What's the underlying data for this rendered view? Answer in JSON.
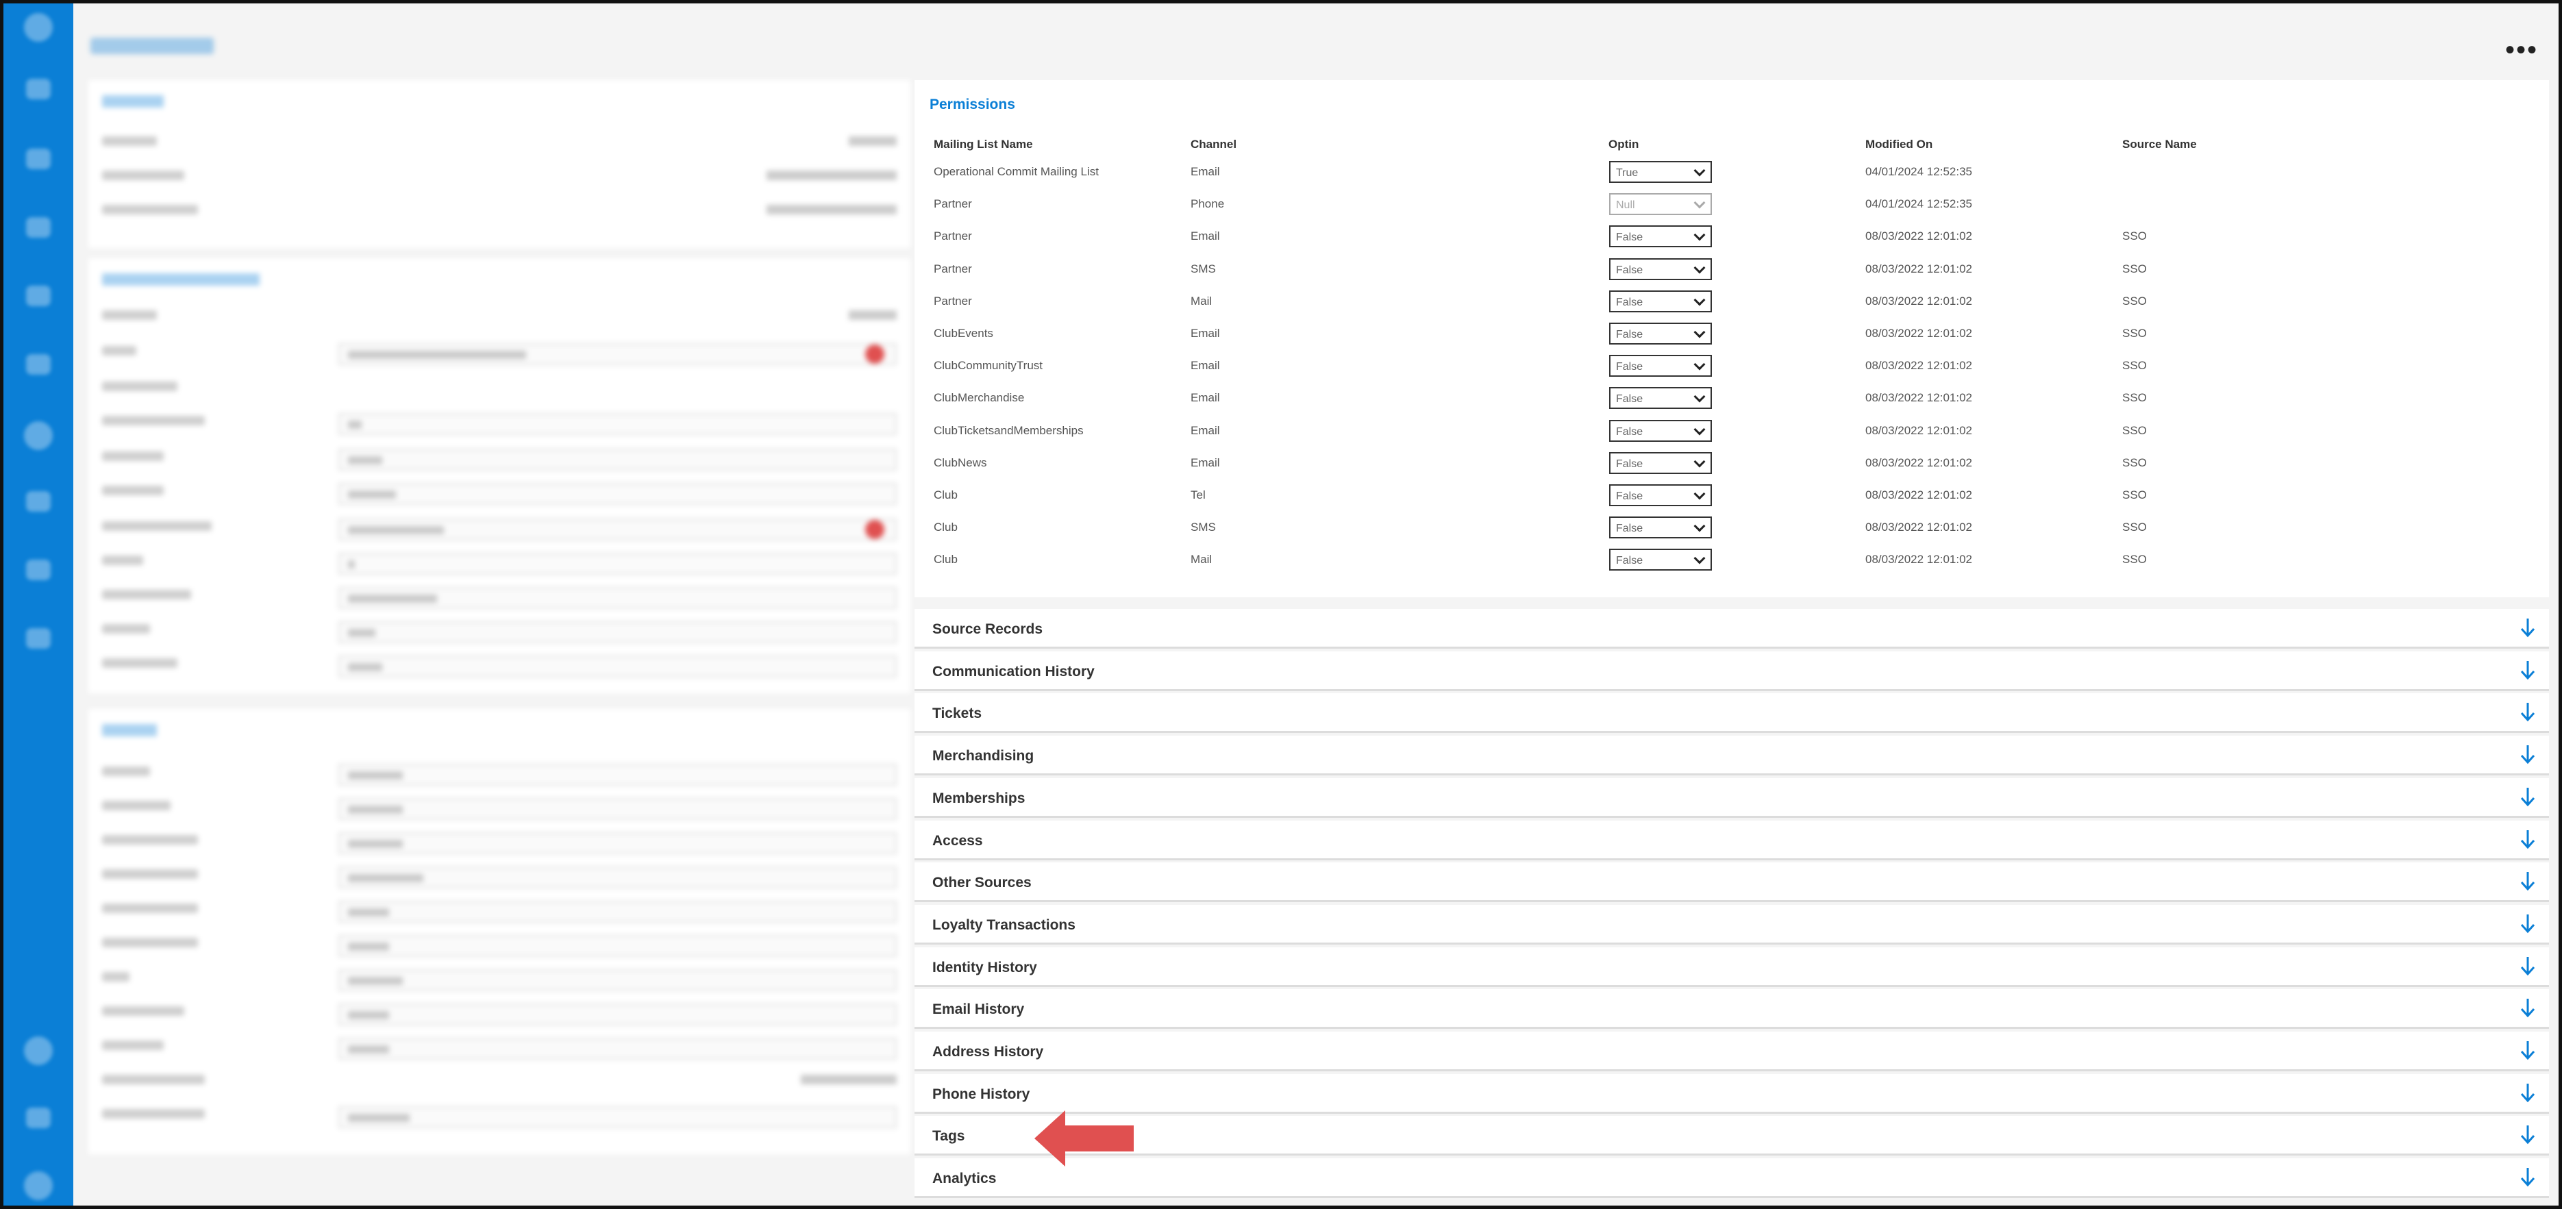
{
  "permissions": {
    "title": "Permissions",
    "headers": {
      "name": "Mailing List Name",
      "channel": "Channel",
      "optin": "Optin",
      "modified": "Modified On",
      "source": "Source Name"
    },
    "rows": [
      {
        "name": "Operational Commit Mailing List",
        "channel": "Email",
        "optin": "True",
        "modified": "04/01/2024 12:52:35",
        "source": ""
      },
      {
        "name": "Partner",
        "channel": "Phone",
        "optin": "Null",
        "modified": "04/01/2024 12:52:35",
        "source": ""
      },
      {
        "name": "Partner",
        "channel": "Email",
        "optin": "False",
        "modified": "08/03/2022 12:01:02",
        "source": "SSO"
      },
      {
        "name": "Partner",
        "channel": "SMS",
        "optin": "False",
        "modified": "08/03/2022 12:01:02",
        "source": "SSO"
      },
      {
        "name": "Partner",
        "channel": "Mail",
        "optin": "False",
        "modified": "08/03/2022 12:01:02",
        "source": "SSO"
      },
      {
        "name": "ClubEvents",
        "channel": "Email",
        "optin": "False",
        "modified": "08/03/2022 12:01:02",
        "source": "SSO"
      },
      {
        "name": "ClubCommunityTrust",
        "channel": "Email",
        "optin": "False",
        "modified": "08/03/2022 12:01:02",
        "source": "SSO"
      },
      {
        "name": "ClubMerchandise",
        "channel": "Email",
        "optin": "False",
        "modified": "08/03/2022 12:01:02",
        "source": "SSO"
      },
      {
        "name": "ClubTicketsandMemberships",
        "channel": "Email",
        "optin": "False",
        "modified": "08/03/2022 12:01:02",
        "source": "SSO"
      },
      {
        "name": "ClubNews",
        "channel": "Email",
        "optin": "False",
        "modified": "08/03/2022 12:01:02",
        "source": "SSO"
      },
      {
        "name": "Club",
        "channel": "Tel",
        "optin": "False",
        "modified": "08/03/2022 12:01:02",
        "source": "SSO"
      },
      {
        "name": "Club",
        "channel": "SMS",
        "optin": "False",
        "modified": "08/03/2022 12:01:02",
        "source": "SSO"
      },
      {
        "name": "Club",
        "channel": "Mail",
        "optin": "False",
        "modified": "08/03/2022 12:01:02",
        "source": "SSO"
      }
    ]
  },
  "sections": [
    "Source Records",
    "Communication History",
    "Tickets",
    "Merchandising",
    "Memberships",
    "Access",
    "Other Sources",
    "Loyalty Transactions",
    "Identity History",
    "Email History",
    "Address History",
    "Phone History",
    "Tags",
    "Analytics"
  ],
  "colors": {
    "accent": "#0b7fd6",
    "annotation_arrow": "#e05050"
  },
  "icons": {
    "more": "more-options-icon",
    "expand": "arrow-down-icon",
    "annotation": "red-left-arrow"
  }
}
